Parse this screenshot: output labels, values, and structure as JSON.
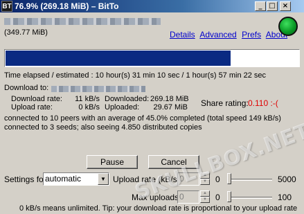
{
  "window": {
    "icon_label": "BT",
    "title": "76.9% (269.18 MiB) – BitTo",
    "minimize": "_",
    "maximize": "□",
    "close": "×"
  },
  "header": {
    "size": "(349.77 MiB)",
    "links": [
      "Details",
      "Advanced",
      "Prefs",
      "About"
    ]
  },
  "progress": {
    "fraction": 0.769
  },
  "stats": {
    "time": "Time elapsed / estimated : 10 hour(s) 31 min 10 sec / 1 hour(s) 57 min 22 sec",
    "download_to_label": "Download to:",
    "download_rate_label": "Download rate:",
    "download_rate": "11 kB/s",
    "upload_rate_label": "Upload rate:",
    "upload_rate": "0 kB/s",
    "downloaded_label": "Downloaded:",
    "downloaded": "269.18 MiB",
    "uploaded_label": "Uploaded:",
    "uploaded": "29.67 MiB",
    "share_label": "Share rating:",
    "share_value": "0.110 :-(",
    "peers": "connected to 10 peers with an average of 45.0% completed (total speed 149 kB/s)",
    "seeds": "connected to 3 seeds; also seeing 4.850 distributed copies"
  },
  "buttons": {
    "pause": "Pause",
    "cancel": "Cancel"
  },
  "settings": {
    "settings_for_label": "Settings for",
    "mode": "automatic",
    "upload_rate_label": "Upload rate (kB/s)",
    "upload_rate_value": "0",
    "upload_min": "0",
    "upload_max": "5000",
    "max_uploads_label": "Max uploads",
    "max_uploads_value": "0",
    "uploads_min": "0",
    "uploads_max": "100",
    "tip": "0 kB/s means unlimited. Tip: your download rate is proportional to your upload rate"
  },
  "watermark": "SKULLBOX.NET",
  "colors": {
    "title_bar": "#0a246a",
    "progress_fill": "#0a2a82",
    "link": "#0000cc",
    "share_rating": "#e00000",
    "status_light": "#0a9a26"
  }
}
